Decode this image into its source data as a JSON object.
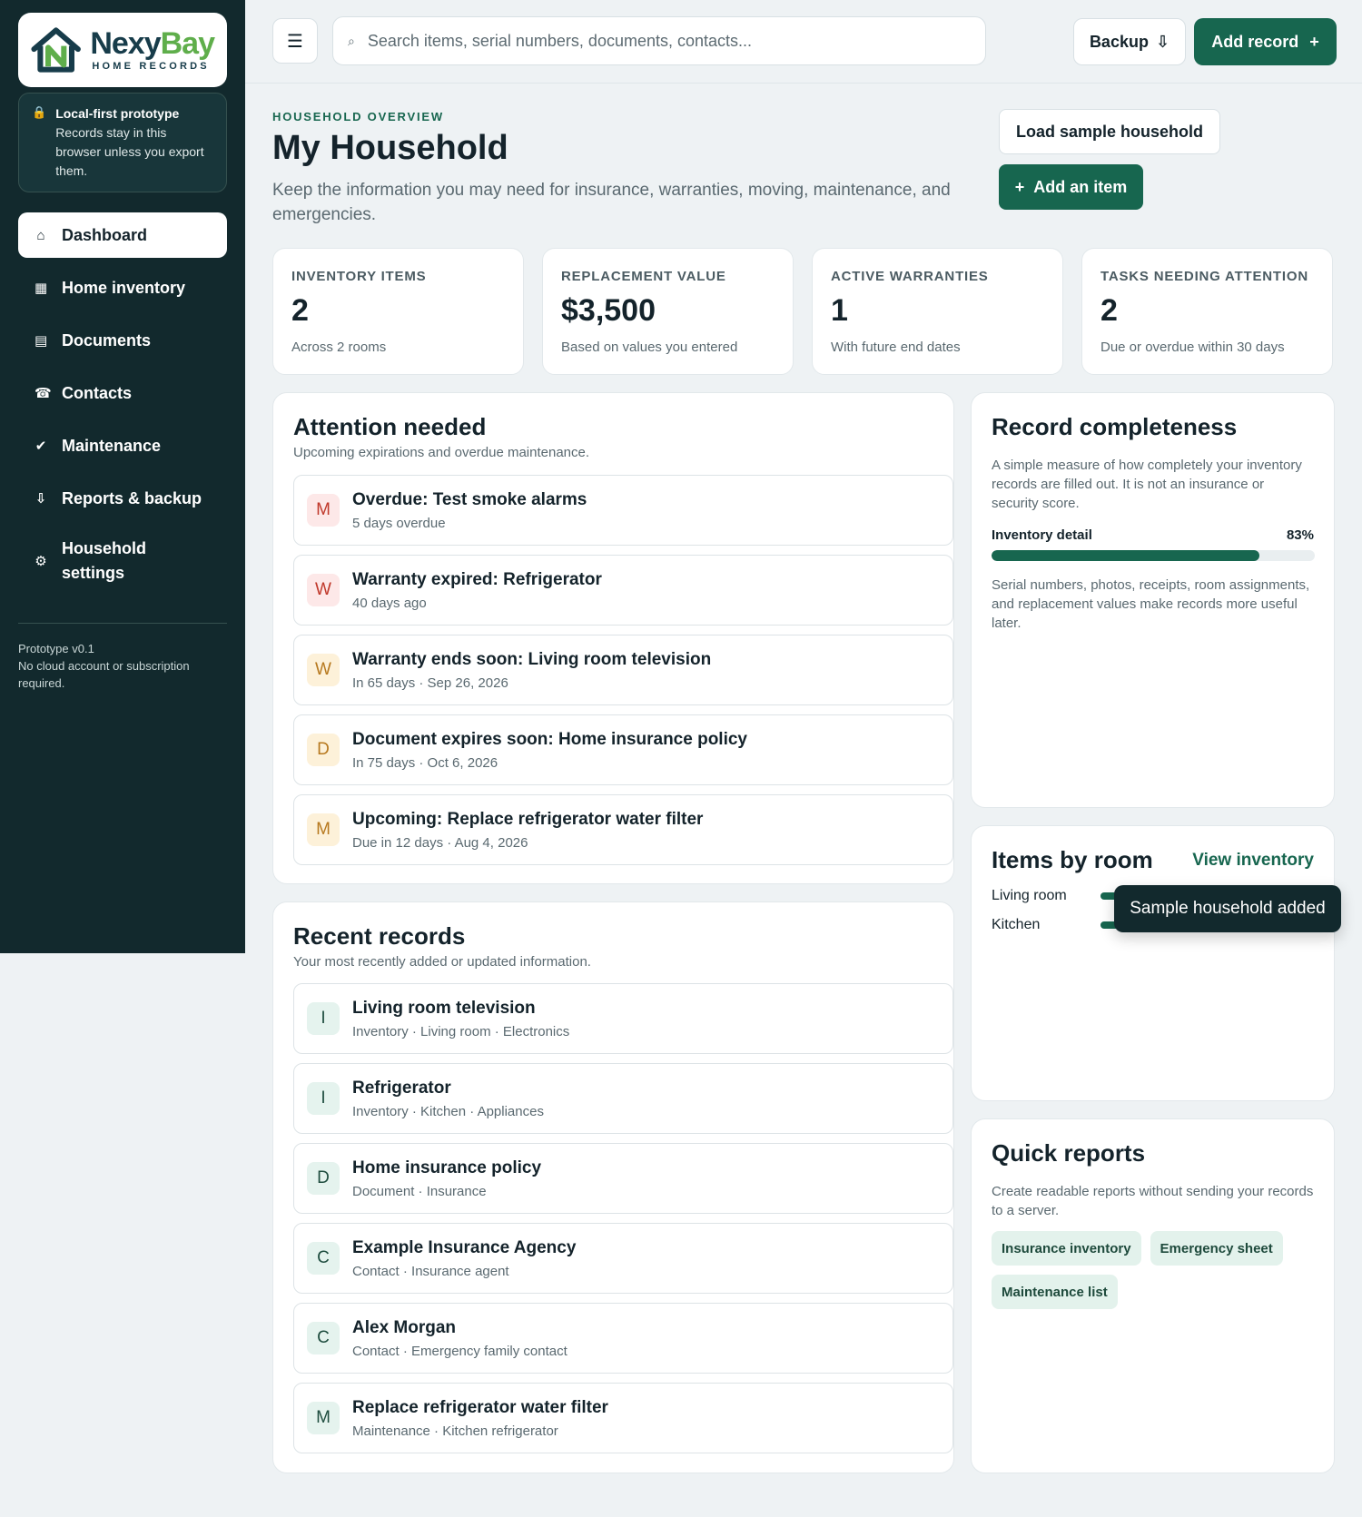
{
  "brand": {
    "name_a": "Nexy",
    "name_b": "Bay",
    "subtitle": "HOME RECORDS"
  },
  "notice": {
    "title": "Local-first prototype",
    "text": "Records stay in this browser unless you export them."
  },
  "nav": [
    {
      "label": "Dashboard",
      "icon": "home-icon",
      "glyph": "⌂"
    },
    {
      "label": "Home inventory",
      "icon": "grid-icon",
      "glyph": "▦"
    },
    {
      "label": "Documents",
      "icon": "document-icon",
      "glyph": "▤"
    },
    {
      "label": "Contacts",
      "icon": "phone-icon",
      "glyph": "☎"
    },
    {
      "label": "Maintenance",
      "icon": "check-icon",
      "glyph": "✔"
    },
    {
      "label": "Reports & backup",
      "icon": "download-icon",
      "glyph": "⇩"
    },
    {
      "label": "Household settings",
      "icon": "gear-icon",
      "glyph": "⚙"
    }
  ],
  "footer": {
    "version": "Prototype v0.1",
    "note": "No cloud account or subscription required."
  },
  "topbar": {
    "menu_glyph": "☰",
    "search_placeholder": "Search items, serial numbers, documents, contacts...",
    "search_glyph": "⌕",
    "backup_label": "Backup",
    "backup_glyph": "⇩",
    "add_record_label": "Add record",
    "add_record_glyph": "+"
  },
  "header": {
    "eyebrow": "HOUSEHOLD OVERVIEW",
    "title": "My Household",
    "description": "Keep the information you may need for insurance, warranties, moving, maintenance, and emergencies.",
    "load_sample_label": "Load sample household",
    "add_item_label": "Add an item",
    "add_item_glyph": "+"
  },
  "stats": [
    {
      "label": "INVENTORY ITEMS",
      "value": "2",
      "sub": "Across 2 rooms"
    },
    {
      "label": "REPLACEMENT VALUE",
      "value": "$3,500",
      "sub": "Based on values you entered"
    },
    {
      "label": "ACTIVE WARRANTIES",
      "value": "1",
      "sub": "With future end dates"
    },
    {
      "label": "TASKS NEEDING ATTENTION",
      "value": "2",
      "sub": "Due or overdue within 30 days"
    }
  ],
  "attention": {
    "title": "Attention needed",
    "subtitle": "Upcoming expirations and overdue maintenance.",
    "items": [
      {
        "badge": "M",
        "tone": "red",
        "title": "Overdue: Test smoke alarms",
        "sub": "5 days overdue"
      },
      {
        "badge": "W",
        "tone": "red",
        "title": "Warranty expired: Refrigerator",
        "sub": "40 days ago"
      },
      {
        "badge": "W",
        "tone": "amber",
        "title": "Warranty ends soon: Living room television",
        "sub": "In 65 days · Sep 26, 2026"
      },
      {
        "badge": "D",
        "tone": "amber",
        "title": "Document expires soon: Home insurance policy",
        "sub": "In 75 days · Oct 6, 2026"
      },
      {
        "badge": "M",
        "tone": "amber",
        "title": "Upcoming: Replace refrigerator water filter",
        "sub": "Due in 12 days · Aug 4, 2026"
      }
    ]
  },
  "recent": {
    "title": "Recent records",
    "subtitle": "Your most recently added or updated information.",
    "items": [
      {
        "badge": "I",
        "title": "Living room television",
        "sub": "Inventory · Living room · Electronics"
      },
      {
        "badge": "I",
        "title": "Refrigerator",
        "sub": "Inventory · Kitchen · Appliances"
      },
      {
        "badge": "D",
        "title": "Home insurance policy",
        "sub": "Document · Insurance"
      },
      {
        "badge": "C",
        "title": "Example Insurance Agency",
        "sub": "Contact · Insurance agent"
      },
      {
        "badge": "C",
        "title": "Alex Morgan",
        "sub": "Contact · Emergency family contact"
      },
      {
        "badge": "M",
        "title": "Replace refrigerator water filter",
        "sub": "Maintenance · Kitchen refrigerator"
      }
    ]
  },
  "completeness": {
    "title": "Record completeness",
    "description": "A simple measure of how completely your inventory records are filled out. It is not an insurance or security score.",
    "metric_label": "Inventory detail",
    "metric_value": "83%",
    "metric_fraction": 0.83,
    "note": "Serial numbers, photos, receipts, room assignments, and replacement values make records more useful later."
  },
  "rooms": {
    "title": "Items by room",
    "link": "View inventory",
    "items": [
      {
        "name": "Living room",
        "count": 1
      },
      {
        "name": "Kitchen",
        "count": 1
      }
    ]
  },
  "toast": "Sample household added",
  "reports": {
    "title": "Quick reports",
    "description": "Create readable reports without sending your records to a server.",
    "chips": [
      "Insurance inventory",
      "Emergency sheet",
      "Maintenance list"
    ]
  },
  "colors": {
    "accent": "#17664f",
    "sidebar": "#12292d",
    "brand_green": "#5fae4b",
    "brand_navy": "#173c4a"
  }
}
